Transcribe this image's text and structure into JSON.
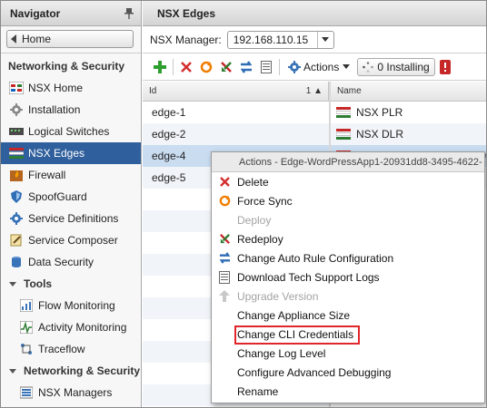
{
  "navigator": {
    "title": "Navigator",
    "home_label": "Home",
    "section_title": "Networking & Security",
    "items": [
      {
        "label": "NSX Home"
      },
      {
        "label": "Installation"
      },
      {
        "label": "Logical Switches"
      },
      {
        "label": "NSX Edges"
      },
      {
        "label": "Firewall"
      },
      {
        "label": "SpoofGuard"
      },
      {
        "label": "Service Definitions"
      },
      {
        "label": "Service Composer"
      },
      {
        "label": "Data Security"
      }
    ],
    "tools": {
      "label": "Tools",
      "items": [
        {
          "label": "Flow Monitoring"
        },
        {
          "label": "Activity Monitoring"
        },
        {
          "label": "Traceflow"
        }
      ]
    },
    "ns_group": {
      "label": "Networking & Security",
      "items": [
        {
          "label": "NSX Managers"
        }
      ]
    }
  },
  "main": {
    "title": "NSX Edges",
    "manager_label": "NSX Manager:",
    "manager_value": "192.168.110.15",
    "actions_label": "Actions",
    "installing_label": "0 Installing",
    "columns": {
      "id": "Id",
      "sort_indicator": "1 ▲",
      "name": "Name"
    },
    "rows": [
      {
        "id": "edge-1",
        "name": "NSX PLR"
      },
      {
        "id": "edge-2",
        "name": "NSX DLR"
      },
      {
        "id": "edge-4",
        "name": "Edge-WordPressApp1-2093"
      },
      {
        "id": "edge-5",
        "name": ""
      }
    ]
  },
  "context_menu": {
    "title": "Actions - Edge-WordPressApp1-20931dd8-3495-4622-",
    "items": [
      {
        "label": "Delete",
        "icon": "delete-x-icon",
        "enabled": true
      },
      {
        "label": "Force Sync",
        "icon": "force-sync-icon",
        "enabled": true
      },
      {
        "label": "Deploy",
        "icon": "",
        "enabled": false
      },
      {
        "label": "Redeploy",
        "icon": "redeploy-icon",
        "enabled": true
      },
      {
        "label": "Change Auto Rule Configuration",
        "icon": "auto-rule-icon",
        "enabled": true
      },
      {
        "label": "Download Tech Support Logs",
        "icon": "logs-icon",
        "enabled": true
      },
      {
        "label": "Upgrade Version",
        "icon": "upgrade-arrow-icon",
        "enabled": false
      },
      {
        "label": "Change Appliance Size",
        "icon": "",
        "enabled": true
      },
      {
        "label": "Change CLI Credentials",
        "icon": "",
        "enabled": true,
        "highlighted": true
      },
      {
        "label": "Change Log Level",
        "icon": "",
        "enabled": true
      },
      {
        "label": "Configure Advanced Debugging",
        "icon": "",
        "enabled": true
      },
      {
        "label": "Rename",
        "icon": "",
        "enabled": true
      }
    ]
  },
  "colors": {
    "selection": "#2f5f9c",
    "row_selection": "#c9dcf0",
    "highlight_box": "#e0262b"
  }
}
